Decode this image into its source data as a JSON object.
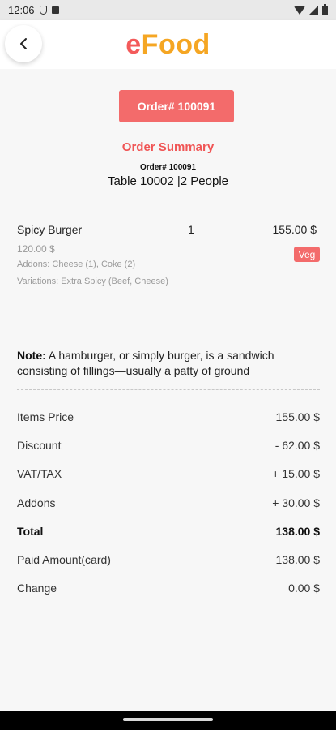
{
  "status_bar": {
    "time": "12:06",
    "icons": [
      "shield-icon",
      "notification-icon",
      "wifi-icon",
      "signal-icon",
      "battery-icon"
    ]
  },
  "app_bar": {
    "back_icon": "back-arrow-icon",
    "logo_e": "e",
    "logo_food": "Food",
    "colors": {
      "logo_e": "#f35a5a",
      "logo_food": "#f5a623"
    }
  },
  "order": {
    "button_label": "Order# 100091",
    "summary_title": "Order Summary",
    "order_small": "Order# 100091",
    "table_info": "Table 10002 |2 People"
  },
  "item": {
    "name": "Spicy Burger",
    "qty": "1",
    "price": "155.00 $",
    "unit_price": "120.00 $",
    "badge": "Veg",
    "addons": "Addons: Cheese (1), Coke (2)",
    "variations": "Variations: Extra Spicy (Beef, Cheese)"
  },
  "note": {
    "label": "Note:",
    "text": " A hamburger, or simply burger, is a sandwich consisting of fillings—usually a patty of ground"
  },
  "summary": {
    "rows": [
      {
        "label": "Items Price",
        "value": "155.00 $"
      },
      {
        "label": "Discount",
        "value": "- 62.00 $"
      },
      {
        "label": "VAT/TAX",
        "value": "+ 15.00 $"
      },
      {
        "label": "Addons",
        "value": "+ 30.00 $"
      },
      {
        "label": "Total",
        "value": "138.00 $"
      },
      {
        "label": "Paid Amount(card)",
        "value": "138.00 $"
      },
      {
        "label": "Change",
        "value": "0.00 $"
      }
    ]
  },
  "theme": {
    "accent": "#f36b6b",
    "accent_text": "#f05555"
  }
}
